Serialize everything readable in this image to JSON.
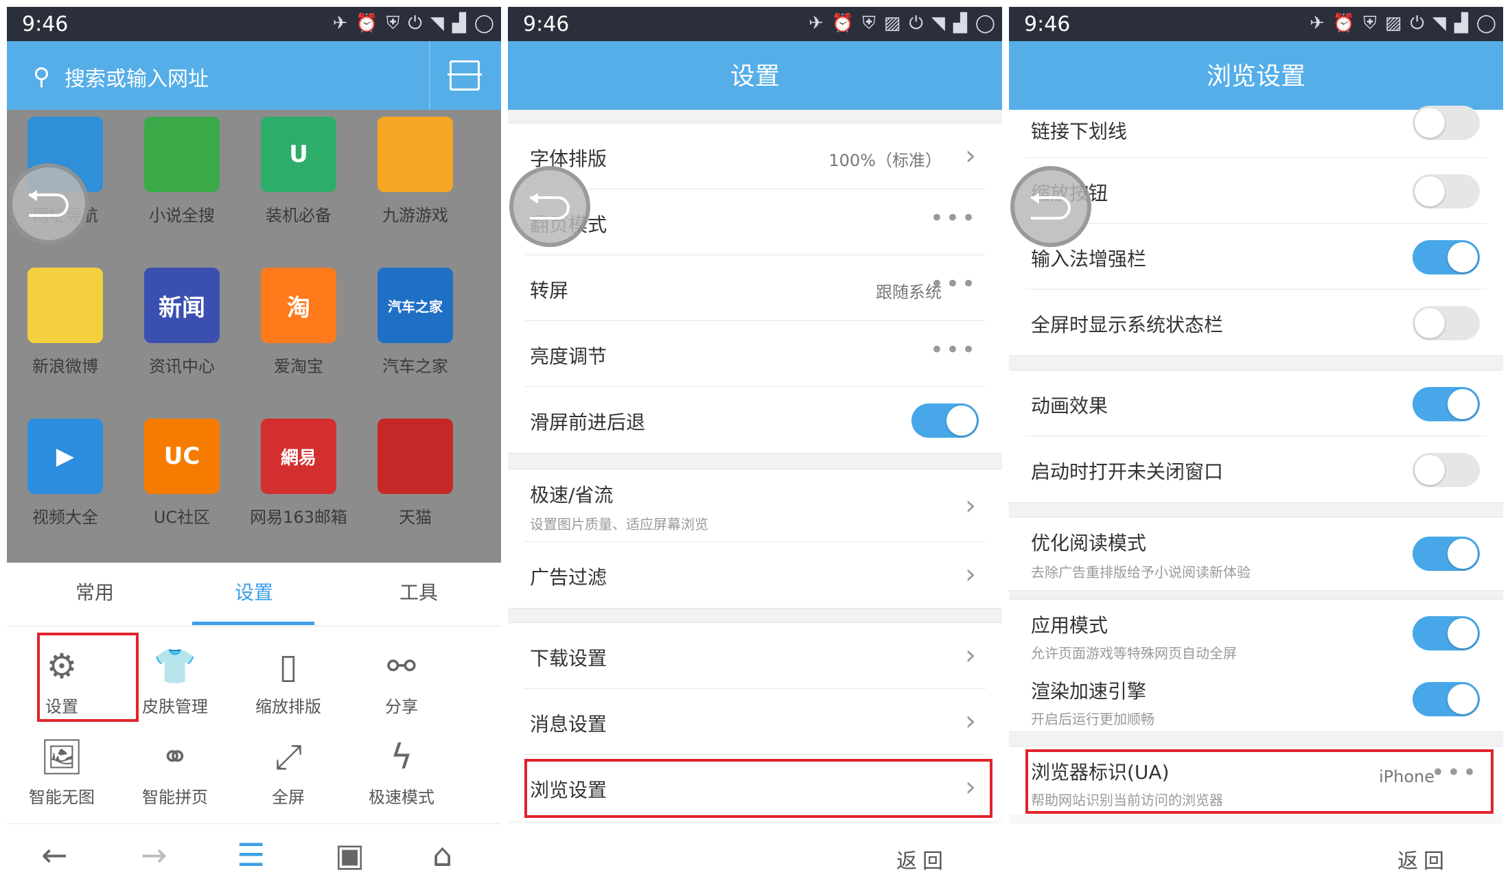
{
  "status": {
    "time": "9:46"
  },
  "p1": {
    "search_placeholder": "搜索或输入网址",
    "apps": [
      {
        "label": "网址导航",
        "glyph": "",
        "color": "#2f8fd8"
      },
      {
        "label": "小说全搜",
        "glyph": "",
        "color": "#3aaa49"
      },
      {
        "label": "装机必备",
        "glyph": "U",
        "color": "#2dad6a"
      },
      {
        "label": "九游游戏",
        "glyph": "",
        "color": "#f5a623"
      },
      {
        "label": "新浪微博",
        "glyph": "",
        "color": "#f4d03f"
      },
      {
        "label": "资讯中心",
        "glyph": "新闻",
        "color": "#3b4fb0"
      },
      {
        "label": "爱淘宝",
        "glyph": "淘",
        "color": "#ff7a1a"
      },
      {
        "label": "汽车之家",
        "glyph": "汽车之家",
        "color": "#1f6fc5"
      },
      {
        "label": "视频大全",
        "glyph": "▶",
        "color": "#2d8ee0"
      },
      {
        "label": "UC社区",
        "glyph": "UC",
        "color": "#f57c00"
      },
      {
        "label": "网易163邮箱",
        "glyph": "網易",
        "color": "#d32f2f"
      },
      {
        "label": "天猫",
        "glyph": "",
        "color": "#c62828"
      }
    ],
    "tabs": [
      "常用",
      "设置",
      "工具"
    ],
    "tools": [
      {
        "label": "设置",
        "icon": "⚙"
      },
      {
        "label": "皮肤管理",
        "icon": "👕"
      },
      {
        "label": "缩放排版",
        "icon": "▯"
      },
      {
        "label": "分享",
        "icon": "⚯"
      },
      {
        "label": "智能无图",
        "icon": "🖼"
      },
      {
        "label": "智能拼页",
        "icon": "⚭"
      },
      {
        "label": "全屏",
        "icon": "⤢"
      },
      {
        "label": "极速模式",
        "icon": "ϟ"
      }
    ],
    "nav": [
      "←",
      "→",
      "☰",
      "▣",
      "⌂"
    ],
    "tab_count": "1"
  },
  "p2": {
    "title": "设置",
    "rows": [
      {
        "label": "字体排版",
        "value": "100%（标准）"
      },
      {
        "label": "翻页模式"
      },
      {
        "label": "转屏",
        "value": "跟随系统"
      },
      {
        "label": "亮度调节"
      },
      {
        "label": "滑屏前进后退",
        "toggle": true
      },
      {
        "label": "极速/省流",
        "sub": "设置图片质量、适应屏幕浏览"
      },
      {
        "label": "广告过滤"
      },
      {
        "label": "下载设置"
      },
      {
        "label": "消息设置"
      },
      {
        "label": "浏览设置"
      }
    ],
    "back": "返回"
  },
  "p3": {
    "title": "浏览设置",
    "rows": [
      {
        "label": "链接下划线",
        "toggle": false
      },
      {
        "label": "缩放按钮",
        "toggle": false
      },
      {
        "label": "输入法增强栏",
        "toggle": true
      },
      {
        "label": "全屏时显示系统状态栏",
        "toggle": false
      },
      {
        "label": "动画效果",
        "toggle": true
      },
      {
        "label": "启动时打开未关闭窗口",
        "toggle": false
      },
      {
        "label": "优化阅读模式",
        "sub": "去除广告重排版给予小说阅读新体验",
        "toggle": true
      },
      {
        "label": "应用模式",
        "sub": "允许页面游戏等特殊网页自动全屏",
        "toggle": true
      },
      {
        "label": "渲染加速引擎",
        "sub": "开启后运行更加顺畅",
        "toggle": true
      },
      {
        "label": "浏览器标识(UA)",
        "sub": "帮助网站识别当前访问的浏览器",
        "value": "iPhone"
      }
    ],
    "back": "返回"
  }
}
